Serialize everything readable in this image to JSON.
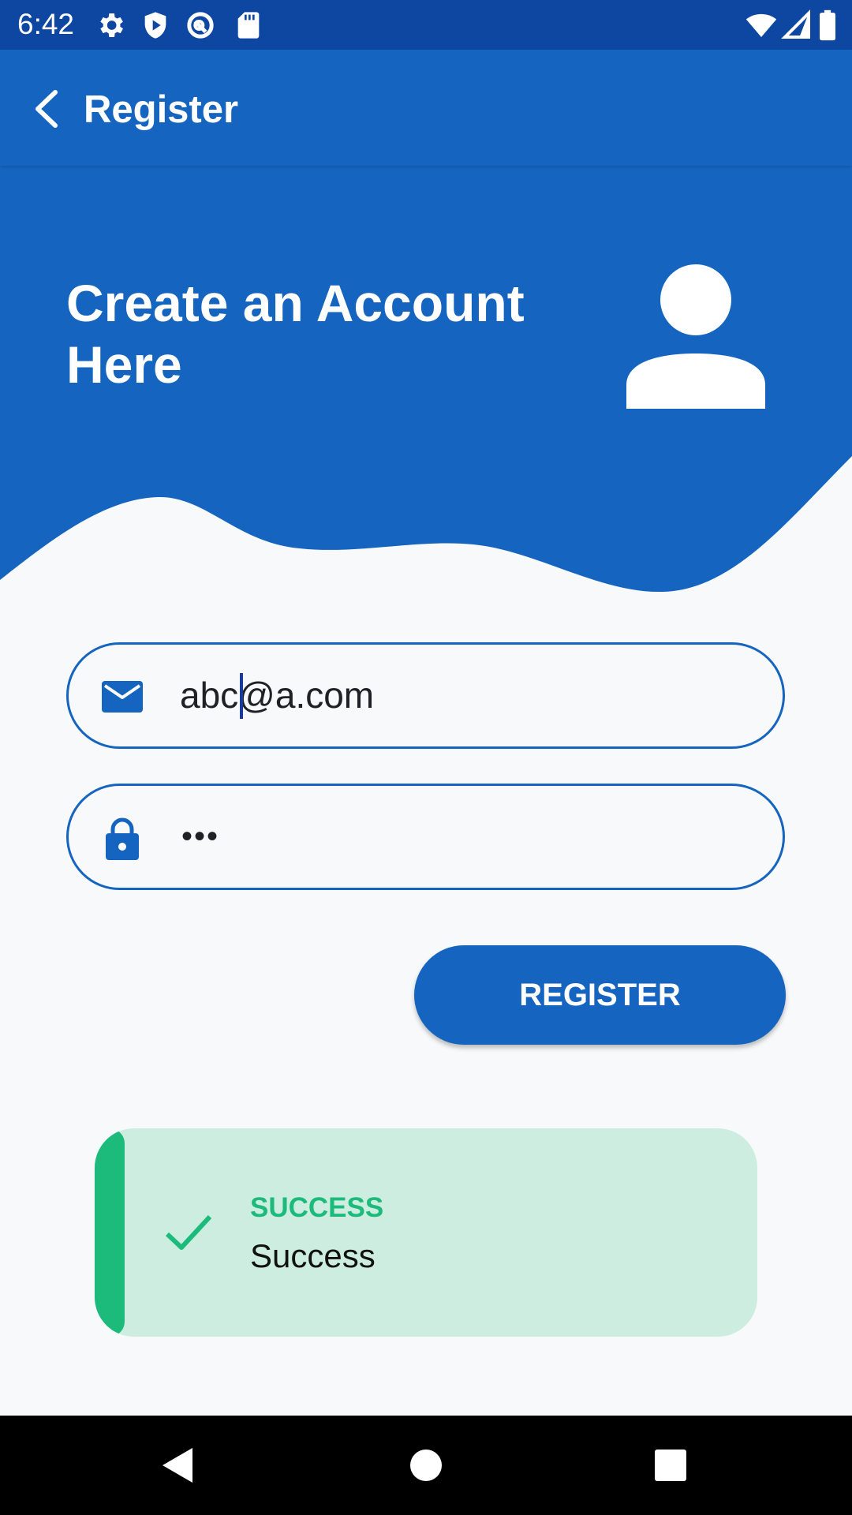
{
  "status_bar": {
    "time": "6:42",
    "left_icons": [
      "gear-icon",
      "shield-play-icon",
      "vpn-icon",
      "sd-card-icon"
    ],
    "right_icons": [
      "wifi-icon",
      "signal-icon",
      "battery-icon"
    ]
  },
  "app_bar": {
    "title": "Register",
    "back_icon": "back-arrow-icon"
  },
  "header": {
    "title": "Create an Account Here",
    "icon": "person-icon"
  },
  "form": {
    "email": {
      "value": "abc@a.com",
      "icon": "mail-icon"
    },
    "password": {
      "value": "•••",
      "icon": "lock-icon"
    },
    "register_label": "REGISTER"
  },
  "toast": {
    "title": "SUCCESS",
    "message": "Success",
    "icon": "check-icon"
  },
  "nav_bar": {
    "buttons": [
      "back-triangle-icon",
      "home-circle-icon",
      "recents-square-icon"
    ]
  },
  "colors": {
    "primary": "#1565c0",
    "status_bar": "#0d47a1",
    "success": "#1cba7b",
    "success_bg": "#cdede0",
    "background": "#f8f9fa"
  }
}
